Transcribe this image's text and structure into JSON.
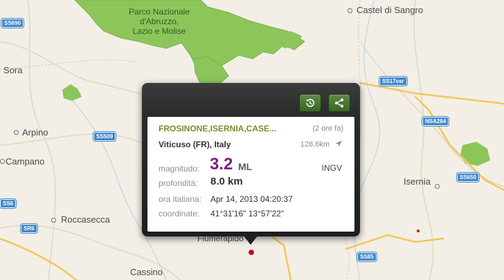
{
  "map": {
    "park_label": "Parco Nazionale\nd'Abruzzo,\nLazio e Molise",
    "places": {
      "castel_di_sangro": "Castel di Sangro",
      "sora": "Sora",
      "arpino": "Arpino",
      "campano": "Campano",
      "roccasecca": "Roccasecca",
      "isernia": "Isernia",
      "cassino": "Cassino",
      "fiumerapido": "Fiumerapido"
    },
    "roads": {
      "ss690": "SS690",
      "ss17var": "SS17var",
      "nsa284": "NSA284",
      "ss509": "SS509",
      "ss650": "SS650",
      "ss6": "SS6",
      "sr6": "SR6",
      "ss85": "SS85"
    },
    "colors": {
      "park": "#8cc65a",
      "road_major": "#f1c75a",
      "road_shield": "#3f86c9",
      "epicenter": "#d0021b"
    }
  },
  "popover": {
    "buttons": {
      "history_icon": "history-icon",
      "share_icon": "share-icon"
    },
    "location": "FROSINONE,ISERNIA,CASE...",
    "time_ago": "(2 ore fa)",
    "place": "Viticuso (FR), Italy",
    "distance": "128.6km",
    "magnitude_label": "magnitudo:",
    "magnitude_value": "3.2",
    "magnitude_unit": "ML",
    "source": "INGV",
    "depth_label": "profondità:",
    "depth_value": "8.0 km",
    "time_label": "ora italiana:",
    "time_value": "Apr 14, 2013 04:20:37",
    "coord_label": "coordinate:",
    "coord_value": "41°31'16\"  13°57'22\""
  }
}
